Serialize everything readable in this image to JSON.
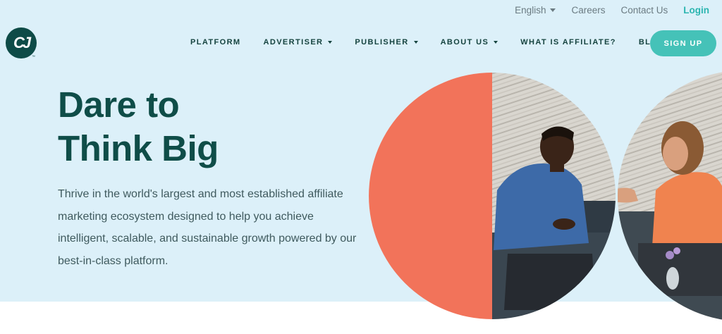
{
  "utility": {
    "language": "English",
    "careers": "Careers",
    "contact": "Contact Us",
    "login": "Login"
  },
  "logo": {
    "mark": "CJ",
    "tm": "™"
  },
  "nav": {
    "platform": "PLATFORM",
    "advertiser": "ADVERTISER",
    "publisher": "PUBLISHER",
    "about": "ABOUT US",
    "what_is_affiliate": "WHAT IS AFFILIATE?",
    "blog": "BLOG",
    "signup": "SIGN UP"
  },
  "hero": {
    "headline_line1": "Dare to",
    "headline_line2": "Think Big",
    "description": "Thrive in the world's largest and most established affiliate marketing ecosystem designed to help you achieve intelligent, scalable, and sustainable growth powered by our best-in-class platform."
  },
  "colors": {
    "hero_bg": "#dcf0f9",
    "brand_dark": "#0f4d48",
    "accent_teal": "#45c2b8",
    "coral": "#f2735a"
  },
  "icons": {
    "language_dropdown": "chevron-down-icon",
    "logo": "cj-logo-icon"
  }
}
